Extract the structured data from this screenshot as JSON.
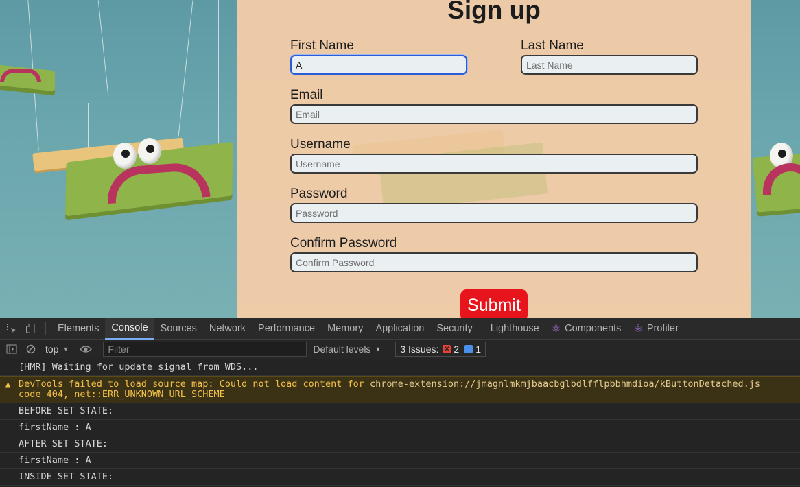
{
  "form": {
    "title": "Sign up",
    "first_name": {
      "label": "First Name",
      "value": "A",
      "placeholder": "First Name"
    },
    "last_name": {
      "label": "Last Name",
      "value": "",
      "placeholder": "Last Name"
    },
    "email": {
      "label": "Email",
      "value": "",
      "placeholder": "Email"
    },
    "username": {
      "label": "Username",
      "value": "",
      "placeholder": "Username"
    },
    "password": {
      "label": "Password",
      "value": "",
      "placeholder": "Password"
    },
    "confirm_password": {
      "label": "Confirm Password",
      "value": "",
      "placeholder": "Confirm Password"
    },
    "submit_label": "Submit",
    "accent_color": "#e8141c"
  },
  "devtools": {
    "tabs": [
      {
        "label": "Elements",
        "active": false
      },
      {
        "label": "Console",
        "active": true
      },
      {
        "label": "Sources",
        "active": false
      },
      {
        "label": "Network",
        "active": false
      },
      {
        "label": "Performance",
        "active": false
      },
      {
        "label": "Memory",
        "active": false
      },
      {
        "label": "Application",
        "active": false
      },
      {
        "label": "Security",
        "active": false
      },
      {
        "label": "Lighthouse",
        "active": false
      },
      {
        "label": "Components",
        "active": false,
        "icon": "react-icon"
      },
      {
        "label": "Profiler",
        "active": false,
        "icon": "react-icon"
      }
    ],
    "toolbar": {
      "context": "top",
      "filter_placeholder": "Filter",
      "levels": "Default levels",
      "issues_label": "3 Issues:",
      "error_count": "2",
      "info_count": "1"
    },
    "console": {
      "hmr": "[HMR] Waiting for update signal from WDS...",
      "warning_prefix": "DevTools failed to load source map: Could not load content for ",
      "warning_link": "chrome-extension://jmagnlmkmjbaacbglbdlfflpbbhmdioa/kButtonDetached.js",
      "warning_line2": "code 404, net::ERR_UNKNOWN_URL_SCHEME",
      "logs": [
        "BEFORE SET STATE:",
        "firstName : A",
        "AFTER SET STATE:",
        "firstName : A",
        "INSIDE SET STATE:"
      ]
    }
  }
}
